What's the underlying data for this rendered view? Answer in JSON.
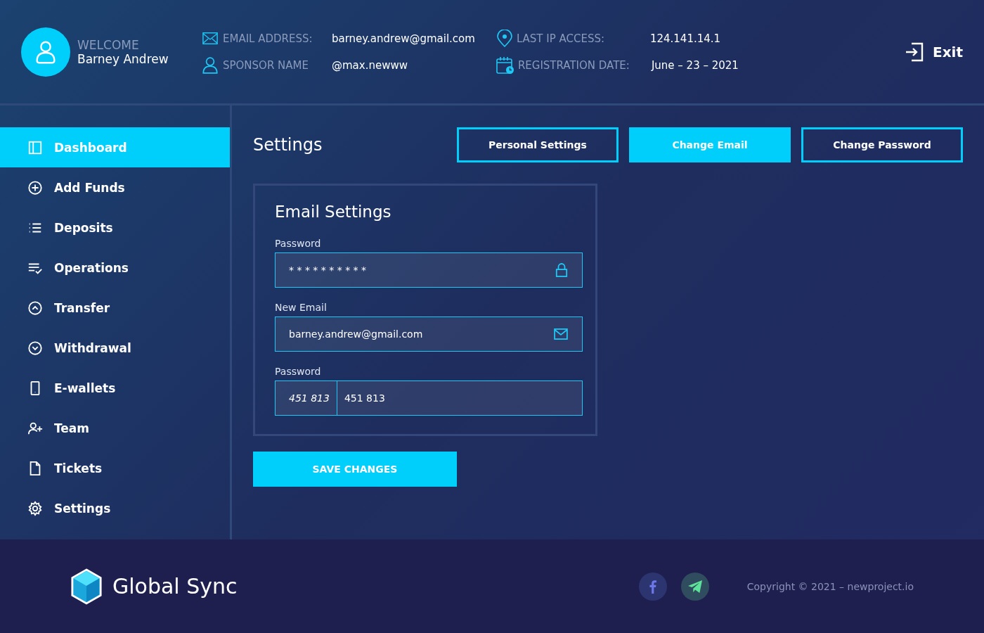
{
  "user": {
    "greeting": "WELCOME",
    "name": "Barney Andrew"
  },
  "info": [
    {
      "kind": "email",
      "label": "EMAIL ADDRESS:",
      "value": "barney.andrew@gmail.com"
    },
    {
      "kind": "sponsor",
      "label": "SPONSOR NAME",
      "value": "@max.newww"
    },
    {
      "kind": "ip",
      "label": "LAST IP ACCESS:",
      "value": "124.141.14.1"
    },
    {
      "kind": "date",
      "label": "REGISTRATION DATE:",
      "value": "June – 23 – 2021"
    }
  ],
  "exit": "Exit",
  "sidebar": {
    "items": [
      {
        "label": "Dashboard",
        "selected": true
      },
      {
        "label": "Add Funds",
        "selected": false
      },
      {
        "label": "Deposits",
        "selected": false
      },
      {
        "label": "Operations",
        "selected": false
      },
      {
        "label": "Transfer",
        "selected": false
      },
      {
        "label": "Withdrawal",
        "selected": false
      },
      {
        "label": "E-wallets",
        "selected": false
      },
      {
        "label": "Team",
        "selected": false
      },
      {
        "label": "Tickets",
        "selected": false
      },
      {
        "label": "Settings",
        "selected": false
      }
    ]
  },
  "page_title": "Settings",
  "tabs": [
    {
      "label": "Personal Settings",
      "selected": false
    },
    {
      "label": "Change Email",
      "selected": true
    },
    {
      "label": "Change Password",
      "selected": false
    }
  ],
  "card": {
    "title": "Email Settings",
    "fields": [
      {
        "kind": "lock",
        "label": "Password",
        "value": "* * * * * * * * * *"
      },
      {
        "kind": "mail",
        "label": "New Email",
        "value": "barney.andrew@gmail.com"
      },
      {
        "kind": "prefix",
        "label": "Password",
        "prefix": "451 813",
        "value": "451 813"
      }
    ]
  },
  "save": "SAVE CHANGES",
  "footer": {
    "brand": "Global Sync",
    "copyright": "Copyright © 2021 – newproject.io"
  }
}
